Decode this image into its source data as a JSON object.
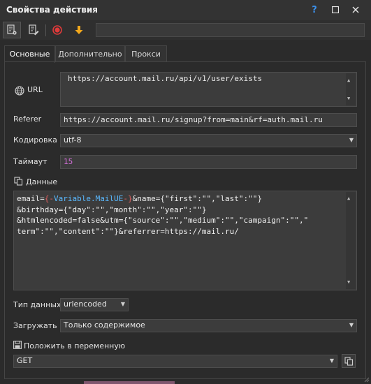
{
  "window": {
    "title": "Свойства действия"
  },
  "titlebar": {
    "help": "?",
    "maximize": "□",
    "close": "✕"
  },
  "tabs": [
    {
      "label": "Основные",
      "selected": true
    },
    {
      "label": "Дополнительно",
      "selected": false
    },
    {
      "label": "Прокси",
      "selected": false
    }
  ],
  "url": {
    "label": "URL",
    "value": "https://account.mail.ru/api/v1/user/exists"
  },
  "referer": {
    "label": "Referer",
    "value": "https://account.mail.ru/signup?from=main&rf=auth.mail.ru"
  },
  "encoding": {
    "label": "Кодировка",
    "value": "utf-8"
  },
  "timeout": {
    "label": "Таймаут",
    "value": "15"
  },
  "data": {
    "label": "Данные",
    "line1_pre": "email=",
    "var_open": "{-",
    "var_name": "Variable.MailUE",
    "var_close": "-}",
    "line1_post": "&name={\"first\":\"\",\"last\":\"\"}",
    "line2": "&birthday={\"day\":\"\",\"month\":\"\",\"year\":\"\"}",
    "line3": "&htmlencoded=false&utm={\"source\":\"\",\"medium\":\"\",\"campaign\":\"\",\"",
    "line4": "term\":\"\",\"content\":\"\"}&referrer=https://mail.ru/"
  },
  "data_type": {
    "label": "Тип данных",
    "value": "urlencoded"
  },
  "load": {
    "label": "Загружать",
    "value": "Только содержимое"
  },
  "save_to": {
    "label": "Положить в переменную",
    "value": "GET"
  },
  "colors": {
    "accent": "#3b8fe8",
    "record": "#e03a3a",
    "arrow": "#f2a81d",
    "variable": "#5ab9ff",
    "brace": "#e36060",
    "number": "#d36fd9"
  }
}
